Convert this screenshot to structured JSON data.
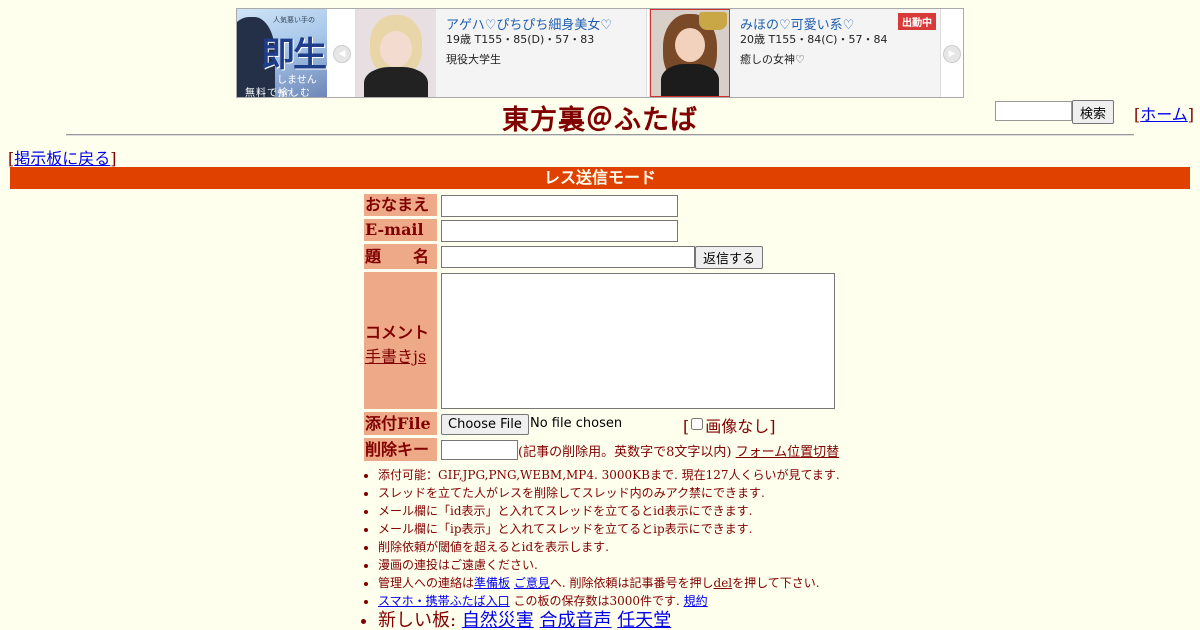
{
  "ad": {
    "left_banner": {
      "small": "人気悪い手の",
      "big": "即生",
      "question": "しませんか？",
      "sub": "無料で愉しむ"
    },
    "cards": [
      {
        "name": "アゲハ♡ぴちぴち細身美女♡",
        "spec": "19歳 T155・85(D)・57・83",
        "desc": "現役大学生",
        "badge": ""
      },
      {
        "name": "みほの♡可愛い系♡",
        "spec": "20歳 T155・84(C)・57・84",
        "desc": "癒しの女神♡",
        "badge": "出勤中"
      }
    ],
    "prev_arrow": "◀",
    "next_arrow": "▶"
  },
  "header": {
    "title": "東方裏＠ふたば",
    "search_button": "検索",
    "home_open": "[",
    "home_link": "ホーム",
    "home_close": "]"
  },
  "nav": {
    "back_open": "[",
    "back_link": "掲示板に戻る",
    "back_close": "]"
  },
  "mode_bar": "レス送信モード",
  "form": {
    "name_label": "おなまえ",
    "email_label": "E-mail",
    "subject_label": "題　　名",
    "submit": "返信する",
    "comment_label": "コメント",
    "handwriting_link": "手書きjs",
    "file_label": "添付File",
    "file_button": "Choose File",
    "file_status": "No file chosen",
    "noimg_open": "[",
    "noimg_label": "画像なし",
    "noimg_close": "]",
    "delkey_label": "削除キー",
    "delkey_note": "(記事の削除用。英数字で8文字以内)",
    "form_toggle": "フォーム位置切替"
  },
  "notes": {
    "n1": "添付可能：GIF,JPG,PNG,WEBM,MP4. 3000KBまで. 現在127人くらいが見てます.",
    "n2": "スレッドを立てた人がレスを削除してスレッド内のみアク禁にできます.",
    "n3": "メール欄に「id表示」と入れてスレッドを立てるとid表示にできます.",
    "n4": "メール欄に「ip表示」と入れてスレッドを立てるとip表示にできます.",
    "n5": "削除依頼が閾値を超えるとidを表示します.",
    "n6": "漫画の連投はご遠慮ください.",
    "n7_a": "管理人への連絡は",
    "n7_link1": "準備板",
    "n7_link2": "ご意見",
    "n7_b": "へ. 削除依頼は記事番号を押し",
    "n7_del": "del",
    "n7_c": "を押して下さい.",
    "n8_link": "スマホ・携帯ふたば入口",
    "n8_text": "この板の保存数は3000件です.",
    "n8_rule": "規約",
    "n9_text": "新しい板:",
    "n9_link1": "自然災害",
    "n9_link2": "合成音声",
    "n9_link3": "任天堂"
  }
}
